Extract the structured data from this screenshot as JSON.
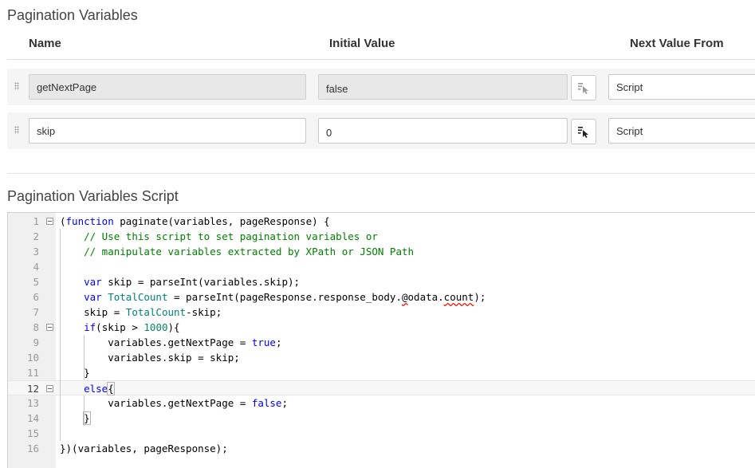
{
  "section1_title": "Pagination Variables",
  "columns": {
    "name": "Name",
    "initial": "Initial Value",
    "next": "Next Value From"
  },
  "rows": [
    {
      "name": "getNextPage",
      "initial": "false",
      "next": "Script",
      "disabled": true
    },
    {
      "name": "skip",
      "initial": "0",
      "next": "Script",
      "disabled": false
    }
  ],
  "section2_title": "Pagination Variables Script",
  "code_lines": [
    {
      "n": "1",
      "text": "(function paginate(variables, pageResponse) {"
    },
    {
      "n": "2",
      "text": "    // Use this script to set pagination variables or"
    },
    {
      "n": "3",
      "text": "    // manipulate variables extracted by XPath or JSON Path"
    },
    {
      "n": "4",
      "text": ""
    },
    {
      "n": "5",
      "text": "    var skip = parseInt(variables.skip);"
    },
    {
      "n": "6",
      "text": "    var TotalCount = parseInt(pageResponse.response_body.@odata.count);"
    },
    {
      "n": "7",
      "text": "    skip = TotalCount-skip;"
    },
    {
      "n": "8",
      "text": "    if(skip > 1000){"
    },
    {
      "n": "9",
      "text": "        variables.getNextPage = true;"
    },
    {
      "n": "10",
      "text": "        variables.skip = skip;"
    },
    {
      "n": "11",
      "text": "    }"
    },
    {
      "n": "12",
      "text": "    else{"
    },
    {
      "n": "13",
      "text": "        variables.getNextPage = false;"
    },
    {
      "n": "14",
      "text": "    }"
    },
    {
      "n": "15",
      "text": ""
    },
    {
      "n": "16",
      "text": "})(variables, pageResponse);"
    }
  ]
}
